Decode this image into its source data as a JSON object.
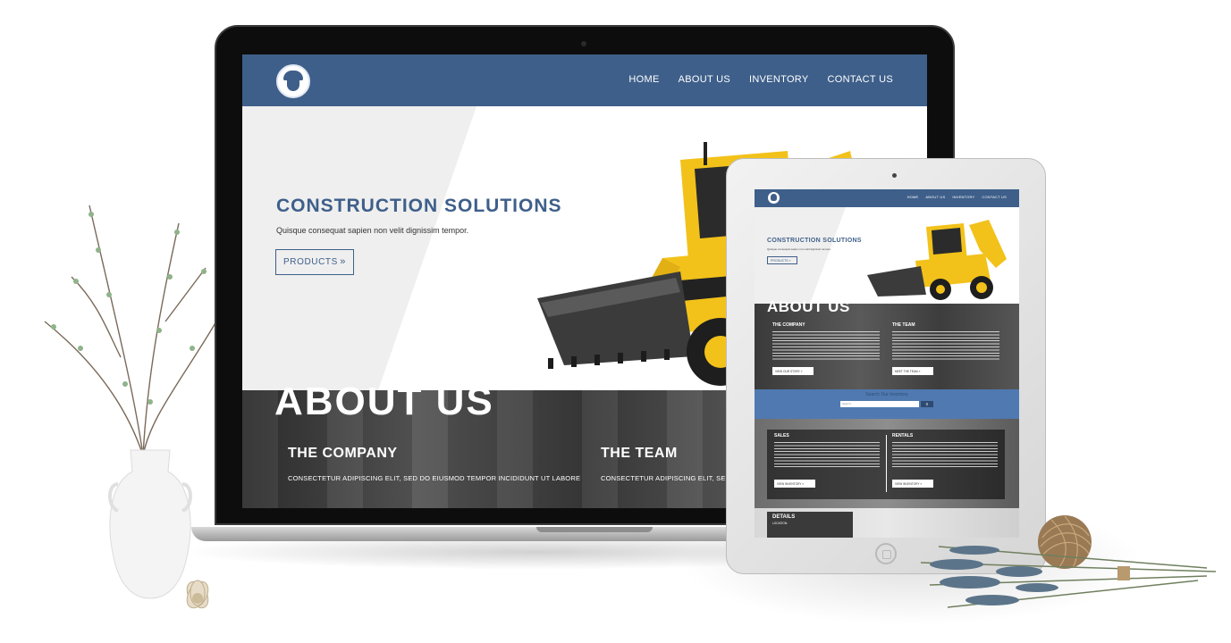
{
  "laptop_site": {
    "nav": {
      "items": [
        "HOME",
        "ABOUT US",
        "INVENTORY",
        "CONTACT US"
      ]
    },
    "hero": {
      "title": "CONSTRUCTION SOLUTIONS",
      "subtitle": "Quisque consequat sapien non velit dignissim tempor.",
      "button_label": "PRODUCTS",
      "button_chevron": "»"
    },
    "about": {
      "title": "ABOUT US",
      "company": {
        "heading": "THE COMPANY",
        "text": "CONSECTETUR ADIPISCING ELIT, SED DO EIUSMOD TEMPOR INCIDIDUNT UT LABORE"
      },
      "team": {
        "heading": "THE TEAM",
        "text": "CONSECTETUR ADIPISCING ELIT, SED D"
      }
    }
  },
  "tablet_site": {
    "nav": {
      "items": [
        "HOME",
        "ABOUT US",
        "INVENTORY",
        "CONTACT US"
      ]
    },
    "hero": {
      "title": "CONSTRUCTION SOLUTIONS",
      "button_label": "PRODUCTS »"
    },
    "about": {
      "title": "ABOUT US",
      "company_heading": "THE COMPANY",
      "company_button": "VIEW OUR STORY »",
      "team_heading": "THE TEAM",
      "team_button": "MEET THE TEAM »"
    },
    "search": {
      "label": "Search Our Inventory",
      "placeholder": "Search...",
      "button_icon": "search-icon"
    },
    "sales": {
      "heading": "SALES",
      "button": "VIEW INVENTORY »"
    },
    "rentals": {
      "heading": "RENTALS",
      "button": "VIEW INVENTORY »"
    },
    "details": {
      "heading": "DETAILS",
      "line": "LOCATION:"
    }
  },
  "colors": {
    "brand_blue": "#3e5f8a",
    "search_bar": "#4f79b0",
    "machine_yellow": "#f2c21b"
  }
}
